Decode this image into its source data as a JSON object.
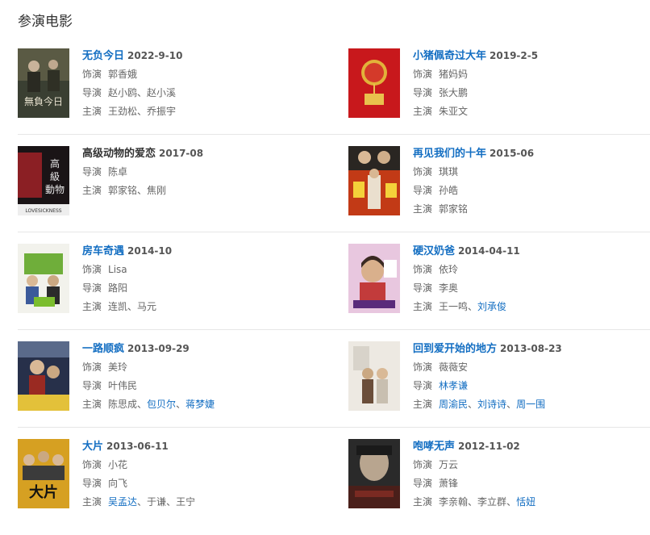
{
  "section": {
    "title": "参演电影"
  },
  "labels": {
    "role": "饰演",
    "director": "导演",
    "cast": "主演",
    "sep": "、"
  },
  "movies": [
    {
      "title": "无负今日",
      "date": "2022-9-10",
      "role": "郭香娥",
      "director": "赵小鸥、赵小溪",
      "cast": [
        "王劲松",
        "乔振宇"
      ]
    },
    {
      "title": "小猪佩奇过大年",
      "date": "2019-2-5",
      "role": "猪妈妈",
      "director": "张大鹏",
      "cast": [
        "朱亚文"
      ]
    },
    {
      "title": "高级动物的爱恋",
      "date": "2017-08",
      "role": "",
      "director": "陈卓",
      "cast": [
        "郭家铭",
        "焦刚"
      ],
      "poster_text": "LOVESICKNESS"
    },
    {
      "title": "再见我们的十年",
      "date": "2015-06",
      "role": "琪琪",
      "director": "孙皓",
      "cast": [
        "郭家铭"
      ]
    },
    {
      "title": "房车奇遇",
      "date": "2014-10",
      "role": "Lisa",
      "director": "路阳",
      "cast": [
        "连凯",
        "马元"
      ]
    },
    {
      "title": "硬汉奶爸",
      "date": "2014-04-11",
      "role": "依玲",
      "director": "李奥",
      "cast": [
        "王一鸣",
        "刘承俊"
      ]
    },
    {
      "title": "一路顺疯",
      "date": "2013-09-29",
      "role": "美玲",
      "director": "叶伟民",
      "cast": [
        "陈思成",
        "包贝尔",
        "蒋梦婕"
      ]
    },
    {
      "title": "回到爱开始的地方",
      "date": "2013-08-23",
      "role": "薇薇安",
      "director": "林孝谦",
      "cast": [
        "周渝民",
        "刘诗诗",
        "周一围"
      ]
    },
    {
      "title": "大片",
      "date": "2013-06-11",
      "role": "小花",
      "director": "向飞",
      "cast": [
        "吴孟达",
        "于谦",
        "王宁"
      ]
    },
    {
      "title": "咆哮无声",
      "date": "2012-11-02",
      "role": "万云",
      "director": "萧锋",
      "cast": [
        "李亲翰",
        "李立群",
        "恬妞"
      ]
    }
  ],
  "colors": {
    "link": "#136ec2",
    "text": "#666666",
    "divider": "#e6e6e6"
  }
}
